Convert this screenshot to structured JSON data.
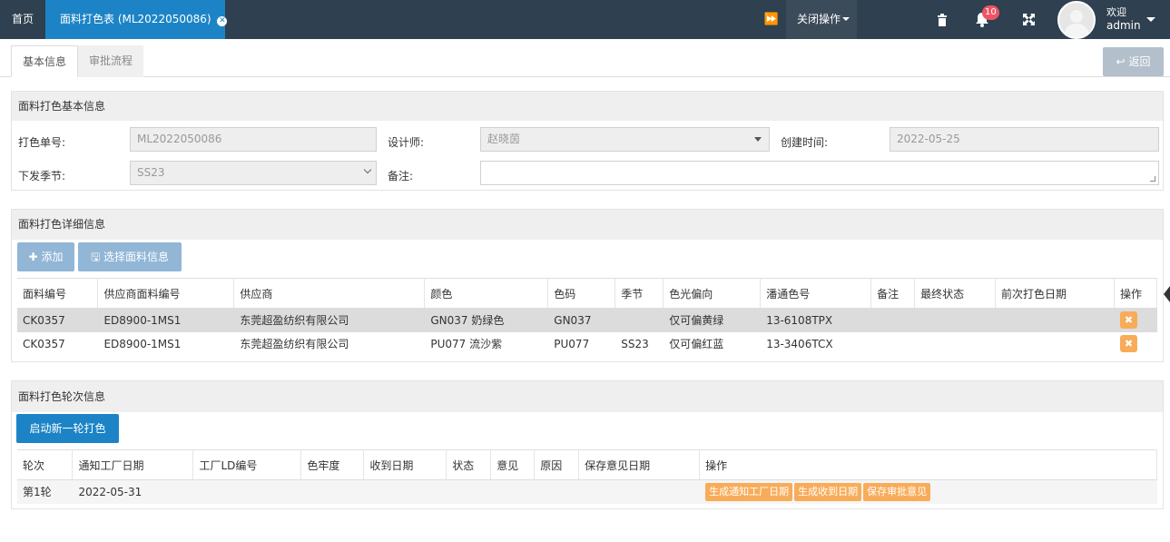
{
  "topbar": {
    "home_tab": "首页",
    "active_tab": "面料打色表 (ML2022050086)",
    "close_ops": "关闭操作",
    "bell_count": "10",
    "welcome": "欢迎",
    "username": "admin",
    "bg_color": "#2f4050",
    "active_tab_color": "#1c84c6"
  },
  "subtabs": {
    "basic": "基本信息",
    "approval": "审批流程",
    "back": "返回"
  },
  "basic_info": {
    "title": "面料打色基本信息",
    "order_no_label": "打色单号:",
    "order_no": "ML2022050086",
    "designer_label": "设计师:",
    "designer": "赵晓茵",
    "created_label": "创建时间:",
    "created": "2022-05-25",
    "season_label": "下发季节:",
    "season": "SS23",
    "remark_label": "备注:",
    "remark": ""
  },
  "detail_info": {
    "title": "面料打色详细信息",
    "add_btn": "添加",
    "select_btn": "选择面料信息",
    "columns": [
      "面料编号",
      "供应商面料编号",
      "供应商",
      "颜色",
      "色码",
      "季节",
      "色光偏向",
      "潘通色号",
      "备注",
      "最终状态",
      "前次打色日期",
      "操作"
    ],
    "rows": [
      [
        "CK0357",
        "ED8900-1MS1",
        "东莞超盈纺织有限公司",
        "GN037 奶绿色",
        "GN037",
        "",
        "仅可偏黄绿",
        "13-6108TPX",
        "",
        "",
        ""
      ],
      [
        "CK0357",
        "ED8900-1MS1",
        "东莞超盈纺织有限公司",
        "PU077 流沙紫",
        "PU077",
        "SS23",
        "仅可偏红蓝",
        "13-3406TCX",
        "",
        "",
        ""
      ]
    ],
    "delete_icon": "✖"
  },
  "round_info": {
    "title": "面料打色轮次信息",
    "start_btn": "启动新一轮打色",
    "columns": [
      "轮次",
      "通知工厂日期",
      "工厂LD编号",
      "色牢度",
      "收到日期",
      "状态",
      "意见",
      "原因",
      "保存意见日期",
      "操作"
    ],
    "rows": [
      [
        "第1轮",
        "2022-05-31",
        "",
        "",
        "",
        "",
        "",
        "",
        ""
      ]
    ],
    "actions": [
      "生成通知工厂日期",
      "生成收到日期",
      "保存审批意见"
    ]
  }
}
